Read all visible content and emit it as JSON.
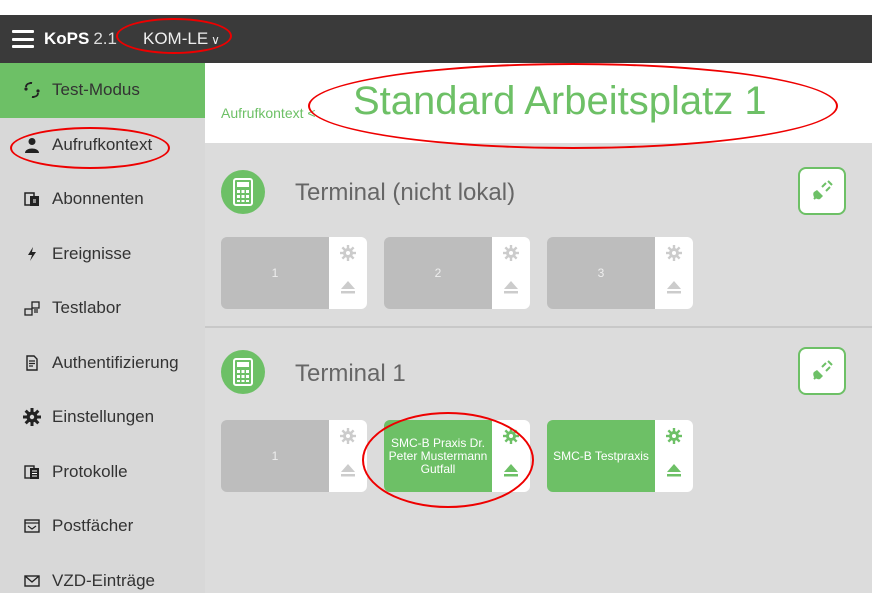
{
  "app": {
    "brand": "KoPS",
    "version": "2.1",
    "context": "KOM-LE",
    "context_chevron": "∨"
  },
  "sidebar": {
    "items": [
      {
        "label": "Test-Modus",
        "icon": "test-mode-icon",
        "active": true
      },
      {
        "label": "Aufrufkontext",
        "icon": "person-icon",
        "active": false
      },
      {
        "label": "Abonnenten",
        "icon": "subscribers-icon",
        "active": false
      },
      {
        "label": "Ereignisse",
        "icon": "lightning-icon",
        "active": false
      },
      {
        "label": "Testlabor",
        "icon": "lab-icon",
        "active": false
      },
      {
        "label": "Authentifizierung",
        "icon": "auth-document-icon",
        "active": false
      },
      {
        "label": "Einstellungen",
        "icon": "gear-icon",
        "active": false
      },
      {
        "label": "Protokolle",
        "icon": "protocol-icon",
        "active": false
      },
      {
        "label": "Postfächer",
        "icon": "mailbox-icon",
        "active": false
      },
      {
        "label": "VZD-Einträge",
        "icon": "envelope-icon",
        "active": false
      }
    ]
  },
  "header": {
    "breadcrumb": "Aufrufkontext <",
    "title": "Standard Arbeitsplatz 1"
  },
  "terminals": [
    {
      "title": "Terminal (nicht lokal)",
      "slots": [
        {
          "label": "1",
          "filled": false
        },
        {
          "label": "2",
          "filled": false
        },
        {
          "label": "3",
          "filled": false
        }
      ]
    },
    {
      "title": "Terminal 1",
      "slots": [
        {
          "label": "1",
          "filled": false
        },
        {
          "label": "SMC-B Praxis Dr. Peter Mustermann Gutfall",
          "filled": true
        },
        {
          "label": "SMC-B Testpraxis",
          "filled": true
        }
      ]
    }
  ],
  "colors": {
    "accent": "#6dc066",
    "topbar": "#3a3a3a",
    "sidebar": "#d8d8d8",
    "content": "#dcdcdc",
    "annotation": "#e00000"
  }
}
